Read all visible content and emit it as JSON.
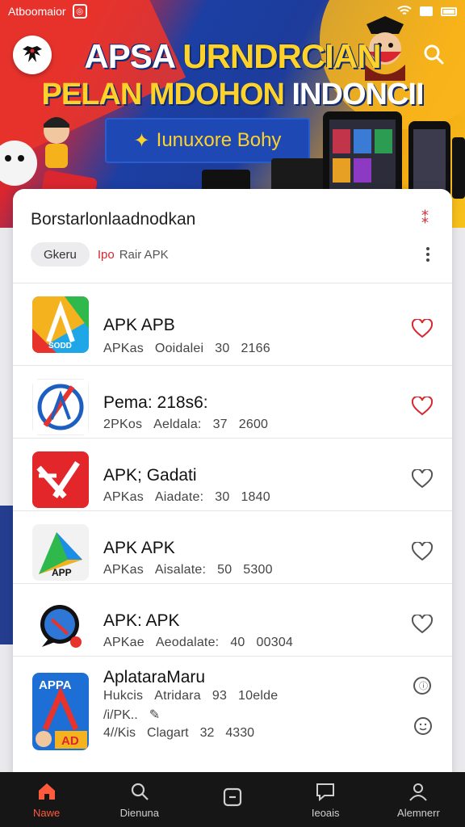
{
  "status_bar": {
    "app_name": "Atboomaior"
  },
  "header": {
    "title_line1_white": "APSA ",
    "title_line1_yellow": "URNDRCIAN",
    "title_line2_yellow": "PELAN MDOHON ",
    "title_line2_white": "INDONCII",
    "promo_text": "Iunuxore  Bohy"
  },
  "card": {
    "title": "Borstarlonlaadnodkan",
    "chips": [
      "Gkeru",
      "Rair APK"
    ],
    "chip_link_prefix": "Ipo"
  },
  "apps": [
    {
      "name": "APK  APB",
      "source": "APKas",
      "category": "Ooidalei",
      "rating": "30",
      "downloads": "2166",
      "favorited": true,
      "icon": "colorful-a-icon"
    },
    {
      "name": "Pema:  218s6:",
      "source": "2PKos",
      "category": "Aeldala:",
      "rating": "37",
      "downloads": "2600",
      "favorited": true,
      "icon": "blue-circle-a-icon"
    },
    {
      "name": "APK;  Gadati",
      "source": "APKas",
      "category": "Aiadate:",
      "rating": "30",
      "downloads": "1840",
      "favorited": false,
      "icon": "red-a-icon"
    },
    {
      "name": "APK   APK",
      "source": "APKas",
      "category": "Aisalate:",
      "rating": "50",
      "downloads": "5300",
      "favorited": false,
      "icon": "green-triangle-icon"
    },
    {
      "name": "APK:  APK",
      "source": "APKae",
      "category": "Aeodalate:",
      "rating": "40",
      "downloads": "00304",
      "favorited": false,
      "icon": "blue-chat-bubble-icon"
    }
  ],
  "last_app": {
    "name": "AplataraMaru",
    "line1": {
      "source": "Hukcis",
      "category": "Atridara",
      "rating": "93",
      "extra": "10elde"
    },
    "line2": "/i/PK..",
    "line3": {
      "source": "4//Kis",
      "category": "Clagart",
      "rating": "32",
      "downloads": "4330"
    },
    "icon_label_top": "APPA",
    "icon_label_bottom": "AD"
  },
  "nav": [
    {
      "label": "Nawe",
      "icon": "home-icon",
      "active": true
    },
    {
      "label": "Dienuna",
      "icon": "search-icon",
      "active": false
    },
    {
      "label": "",
      "icon": "minus-square-icon",
      "active": false
    },
    {
      "label": "Ieoais",
      "icon": "chat-icon",
      "active": false
    },
    {
      "label": "Alemnerr",
      "icon": "profile-icon",
      "active": false
    }
  ],
  "colors": {
    "accent": "#d9262f",
    "banner_blue": "#1d3c9b",
    "banner_yellow": "#ffd22a",
    "nav_active": "#ff5a3c",
    "nav_bg": "#161616"
  }
}
